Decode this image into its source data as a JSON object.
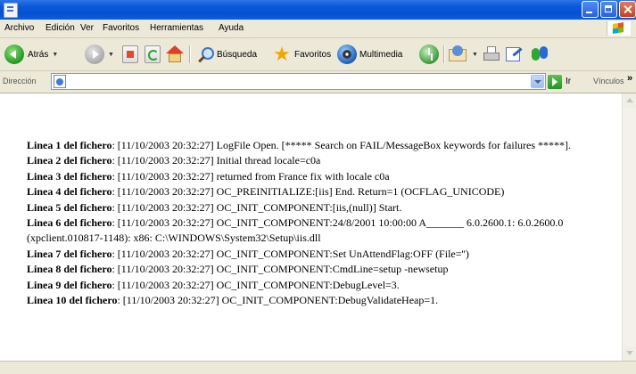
{
  "menubar": {
    "items": [
      "Archivo",
      "Edición",
      "Ver",
      "Favoritos",
      "Herramientas",
      "Ayuda"
    ]
  },
  "toolbar": {
    "back_label": "Atrás",
    "search_label": "Búsqueda",
    "favorites_label": "Favoritos",
    "media_label": "Multimedia"
  },
  "address_bar": {
    "label": "Dirección",
    "value": "",
    "go_label": "Ir",
    "links_label": "Vínculos",
    "more": "»"
  },
  "log": {
    "lines": [
      {
        "prefix": "Linea 1 del fichero",
        "text": ": [11/10/2003 20:32:27] LogFile Open. [***** Search on FAIL/MessageBox keywords for failures *****]."
      },
      {
        "prefix": "Linea 2 del fichero",
        "text": ": [11/10/2003 20:32:27] Initial thread locale=c0a"
      },
      {
        "prefix": "Linea 3 del fichero",
        "text": ": [11/10/2003 20:32:27] returned from France fix with locale c0a"
      },
      {
        "prefix": "Linea 4 del fichero",
        "text": ": [11/10/2003 20:32:27] OC_PREINITIALIZE:[iis] End. Return=1 (OCFLAG_UNICODE)"
      },
      {
        "prefix": "Linea 5 del fichero",
        "text": ": [11/10/2003 20:32:27] OC_INIT_COMPONENT:[iis,(null)] Start."
      },
      {
        "prefix": "Linea 6 del fichero",
        "text": ": [11/10/2003 20:32:27] OC_INIT_COMPONENT:24/8/2001 10:00:00 A_______ 6.0.2600.1: 6.0.2600.0 (xpclient.010817-1148): x86: C:\\WINDOWS\\System32\\Setup\\iis.dll"
      },
      {
        "prefix": "Linea 7 del fichero",
        "text": ": [11/10/2003 20:32:27] OC_INIT_COMPONENT:Set UnAttendFlag:OFF (File='')"
      },
      {
        "prefix": "Linea 8 del fichero",
        "text": ": [11/10/2003 20:32:27] OC_INIT_COMPONENT:CmdLine=setup -newsetup"
      },
      {
        "prefix": "Linea 9 del fichero",
        "text": ": [11/10/2003 20:32:27] OC_INIT_COMPONENT:DebugLevel=3."
      },
      {
        "prefix": "Linea 10 del fichero",
        "text": ": [11/10/2003 20:32:27] OC_INIT_COMPONENT:DebugValidateHeap=1."
      }
    ]
  }
}
